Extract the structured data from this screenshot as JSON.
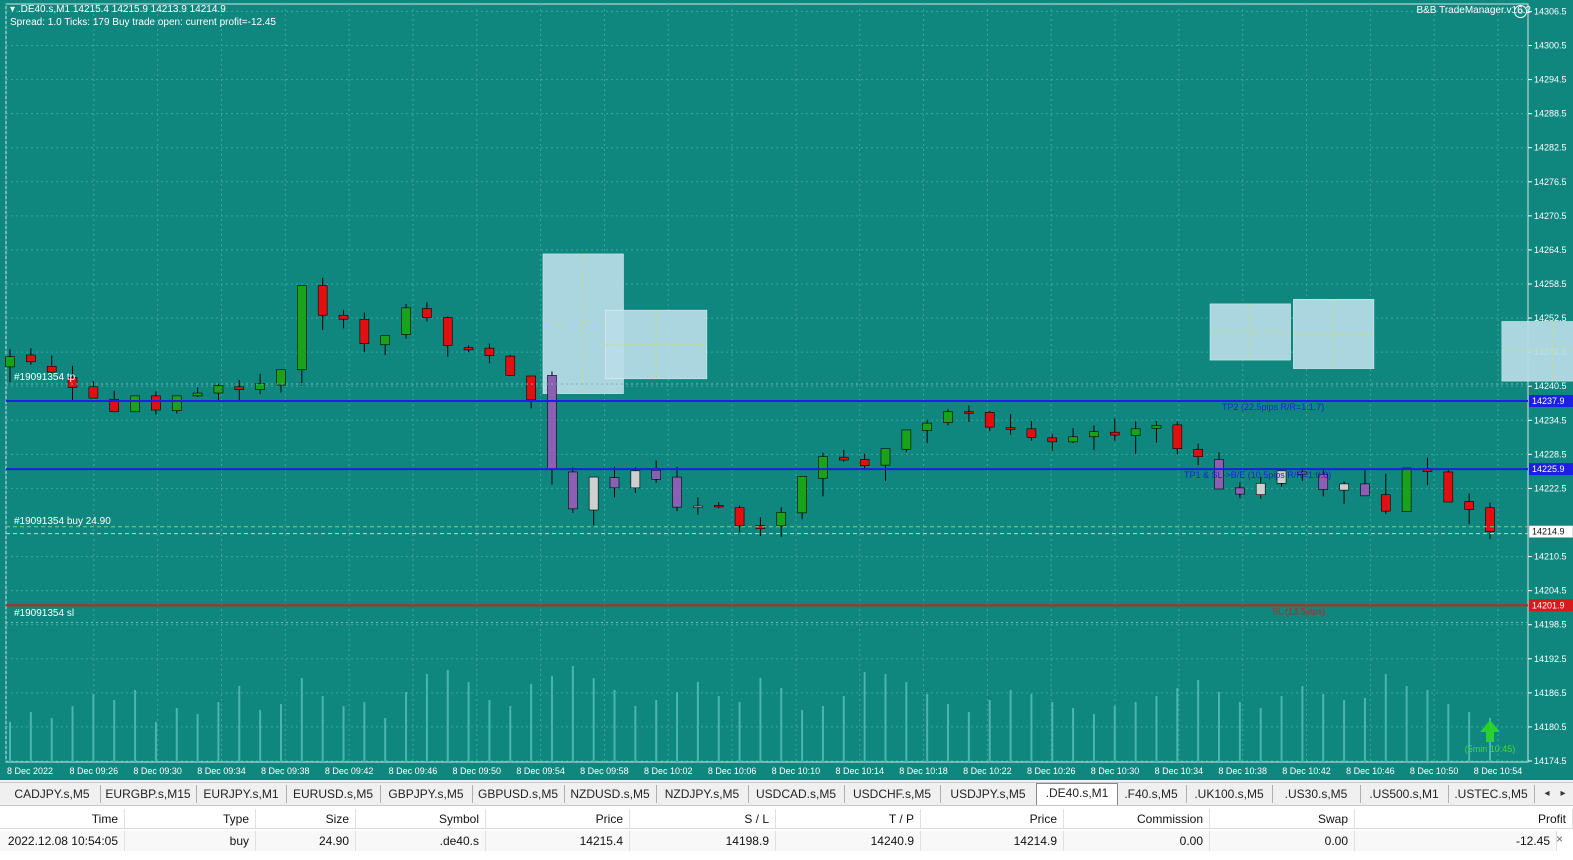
{
  "header": {
    "symbol_line": ".DE40.s,M1  14215.4 14215.9 14213.9 14214.9",
    "status_line": "Spread: 1.0   Ticks: 179   Buy trade open: current profit=-12.45",
    "brand": "B&B TradeManager.v16.2",
    "brand_icon": "smiley-icon"
  },
  "colors": {
    "background": "#0f867e",
    "bull": "#1aa31a",
    "bear": "#e01010",
    "pattern_box": "#b9dde8",
    "pattern_candle": "#8a5fb4",
    "tp_line": "#1e1ee6",
    "sl_line": "#d81a1a",
    "arrow": "#2ad12a"
  },
  "price_axis": {
    "labels": [
      "14306.5",
      "14300.5",
      "14294.5",
      "14288.5",
      "14282.5",
      "14276.5",
      "14270.5",
      "14264.5",
      "14258.5",
      "14252.5",
      "14246.5",
      "14240.5",
      "14234.5",
      "14228.5",
      "14222.5",
      "14210.5",
      "14204.5",
      "14198.5",
      "14192.5",
      "14186.5",
      "14180.5",
      "14174.5"
    ],
    "current_price": "14214.9",
    "tp2_price": "14237.9",
    "tp1_price": "14225.9",
    "sl_price": "14201.9"
  },
  "time_axis": {
    "labels": [
      "8 Dec 2022",
      "8 Dec 09:26",
      "8 Dec 09:30",
      "8 Dec 09:34",
      "8 Dec 09:38",
      "8 Dec 09:42",
      "8 Dec 09:46",
      "8 Dec 09:50",
      "8 Dec 09:54",
      "8 Dec 09:58",
      "8 Dec 10:02",
      "8 Dec 10:06",
      "8 Dec 10:10",
      "8 Dec 10:14",
      "8 Dec 10:18",
      "8 Dec 10:22",
      "8 Dec 10:26",
      "8 Dec 10:30",
      "8 Dec 10:34",
      "8 Dec 10:38",
      "8 Dec 10:42",
      "8 Dec 10:46",
      "8 Dec 10:50",
      "8 Dec 10:54"
    ]
  },
  "order_labels": {
    "tp": "#19091354 tp",
    "buy": "#19091354 buy 24.90",
    "sl": "#19091354 sl"
  },
  "line_annotations": {
    "tp2": "TP2 (22.5pips R/R=1:1.7)",
    "tp1": "TP1 & SL->B/E (10.5pips R/R=1:0.8)",
    "sl": "SL (13.5pips)"
  },
  "timer": "(5min 10:45)",
  "chart_data": {
    "type": "candlestick",
    "symbol": ".DE40.s",
    "timeframe": "M1",
    "ylim": [
      14174,
      14307
    ],
    "candles": [
      {
        "o": 14243.9,
        "h": 14247.0,
        "l": 14241.2,
        "c": 14245.7
      },
      {
        "o": 14246.0,
        "h": 14247.2,
        "l": 14244.3,
        "c": 14244.8
      },
      {
        "o": 14244.0,
        "h": 14245.9,
        "l": 14242.4,
        "c": 14243.0
      },
      {
        "o": 14242.0,
        "h": 14244.1,
        "l": 14238.0,
        "c": 14240.3
      },
      {
        "o": 14240.4,
        "h": 14241.4,
        "l": 14239.5,
        "c": 14238.4
      },
      {
        "o": 14238.2,
        "h": 14239.7,
        "l": 14237.7,
        "c": 14236.0
      },
      {
        "o": 14236.0,
        "h": 14238.7,
        "l": 14236.0,
        "c": 14238.8
      },
      {
        "o": 14238.8,
        "h": 14239.6,
        "l": 14235.5,
        "c": 14236.3
      },
      {
        "o": 14236.2,
        "h": 14238.7,
        "l": 14235.7,
        "c": 14238.8
      },
      {
        "o": 14238.8,
        "h": 14240.3,
        "l": 14238.6,
        "c": 14239.3
      },
      {
        "o": 14239.3,
        "h": 14240.9,
        "l": 14237.9,
        "c": 14240.6
      },
      {
        "o": 14240.4,
        "h": 14241.6,
        "l": 14237.8,
        "c": 14239.9
      },
      {
        "o": 14239.9,
        "h": 14242.7,
        "l": 14239.1,
        "c": 14241.0
      },
      {
        "o": 14240.7,
        "h": 14243.2,
        "l": 14239.4,
        "c": 14243.4
      },
      {
        "o": 14243.4,
        "h": 14244.3,
        "l": 14240.6,
        "c": 14258.2
      },
      {
        "o": 14258.2,
        "h": 14259.6,
        "l": 14250.4,
        "c": 14253.0
      },
      {
        "o": 14253.0,
        "h": 14253.9,
        "l": 14250.7,
        "c": 14252.3
      },
      {
        "o": 14252.3,
        "h": 14253.5,
        "l": 14246.5,
        "c": 14248.0
      },
      {
        "o": 14247.8,
        "h": 14249.1,
        "l": 14246.0,
        "c": 14249.4
      },
      {
        "o": 14249.6,
        "h": 14255.0,
        "l": 14248.9,
        "c": 14254.3
      },
      {
        "o": 14254.2,
        "h": 14255.3,
        "l": 14251.9,
        "c": 14252.6
      },
      {
        "o": 14252.6,
        "h": 14252.8,
        "l": 14245.7,
        "c": 14247.7
      },
      {
        "o": 14247.3,
        "h": 14247.7,
        "l": 14246.5,
        "c": 14246.9
      },
      {
        "o": 14247.2,
        "h": 14248.0,
        "l": 14244.6,
        "c": 14245.9
      },
      {
        "o": 14245.8,
        "h": 14246.0,
        "l": 14242.3,
        "c": 14242.4
      },
      {
        "o": 14242.3,
        "h": 14242.3,
        "l": 14236.6,
        "c": 14238.1
      },
      {
        "o": 14242.4,
        "h": 14243.1,
        "l": 14223.2,
        "c": 14225.8
      },
      {
        "o": 14225.4,
        "h": 14226.2,
        "l": 14218.2,
        "c": 14218.9
      },
      {
        "o": 14218.7,
        "h": 14223.2,
        "l": 14216.0,
        "c": 14224.5
      },
      {
        "o": 14224.4,
        "h": 14226.3,
        "l": 14220.9,
        "c": 14222.6
      },
      {
        "o": 14222.6,
        "h": 14226.2,
        "l": 14221.7,
        "c": 14225.6
      },
      {
        "o": 14225.7,
        "h": 14227.4,
        "l": 14223.5,
        "c": 14224.1
      },
      {
        "o": 14224.5,
        "h": 14226.3,
        "l": 14218.5,
        "c": 14219.2
      },
      {
        "o": 14219.3,
        "h": 14220.9,
        "l": 14217.9,
        "c": 14219.4
      },
      {
        "o": 14219.5,
        "h": 14220.1,
        "l": 14219.0,
        "c": 14219.4
      },
      {
        "o": 14219.1,
        "h": 14219.5,
        "l": 14214.8,
        "c": 14215.9
      },
      {
        "o": 14216.0,
        "h": 14217.4,
        "l": 14214.1,
        "c": 14215.4
      },
      {
        "o": 14215.9,
        "h": 14219.2,
        "l": 14214.0,
        "c": 14218.3
      },
      {
        "o": 14218.2,
        "h": 14223.7,
        "l": 14217.1,
        "c": 14224.6
      },
      {
        "o": 14224.3,
        "h": 14228.8,
        "l": 14221.1,
        "c": 14228.1
      },
      {
        "o": 14228.0,
        "h": 14229.3,
        "l": 14227.2,
        "c": 14227.5
      },
      {
        "o": 14227.6,
        "h": 14228.6,
        "l": 14225.7,
        "c": 14226.5
      },
      {
        "o": 14226.6,
        "h": 14227.5,
        "l": 14223.8,
        "c": 14229.5
      },
      {
        "o": 14229.4,
        "h": 14232.3,
        "l": 14228.9,
        "c": 14232.8
      },
      {
        "o": 14232.7,
        "h": 14234.6,
        "l": 14230.5,
        "c": 14234.0
      },
      {
        "o": 14234.1,
        "h": 14236.5,
        "l": 14233.6,
        "c": 14236.0
      },
      {
        "o": 14236.0,
        "h": 14237.1,
        "l": 14234.2,
        "c": 14235.9
      },
      {
        "o": 14235.9,
        "h": 14236.1,
        "l": 14232.6,
        "c": 14233.3
      },
      {
        "o": 14233.2,
        "h": 14235.6,
        "l": 14232.0,
        "c": 14232.9
      },
      {
        "o": 14233.0,
        "h": 14234.4,
        "l": 14230.9,
        "c": 14231.5
      },
      {
        "o": 14231.4,
        "h": 14232.1,
        "l": 14229.1,
        "c": 14230.7
      },
      {
        "o": 14230.7,
        "h": 14233.1,
        "l": 14230.5,
        "c": 14231.6
      },
      {
        "o": 14231.6,
        "h": 14233.6,
        "l": 14229.3,
        "c": 14232.5
      },
      {
        "o": 14232.4,
        "h": 14234.8,
        "l": 14230.9,
        "c": 14231.9
      },
      {
        "o": 14231.8,
        "h": 14234.3,
        "l": 14228.6,
        "c": 14233.0
      },
      {
        "o": 14233.1,
        "h": 14234.4,
        "l": 14230.6,
        "c": 14233.6
      },
      {
        "o": 14233.7,
        "h": 14234.3,
        "l": 14228.5,
        "c": 14229.5
      },
      {
        "o": 14229.4,
        "h": 14230.4,
        "l": 14226.6,
        "c": 14228.1
      },
      {
        "o": 14227.6,
        "h": 14228.9,
        "l": 14222.7,
        "c": 14222.4
      },
      {
        "o": 14222.6,
        "h": 14223.6,
        "l": 14220.8,
        "c": 14221.5
      },
      {
        "o": 14221.4,
        "h": 14224.5,
        "l": 14220.7,
        "c": 14223.4
      },
      {
        "o": 14223.4,
        "h": 14225.0,
        "l": 14222.8,
        "c": 14225.6
      },
      {
        "o": 14225.4,
        "h": 14226.1,
        "l": 14223.8,
        "c": 14225.0
      },
      {
        "o": 14225.0,
        "h": 14225.8,
        "l": 14221.1,
        "c": 14222.3
      },
      {
        "o": 14222.2,
        "h": 14223.7,
        "l": 14219.8,
        "c": 14223.3
      },
      {
        "o": 14223.3,
        "h": 14225.9,
        "l": 14221.3,
        "c": 14221.2
      },
      {
        "o": 14221.4,
        "h": 14225.1,
        "l": 14218.0,
        "c": 14218.5
      },
      {
        "o": 14218.4,
        "h": 14224.6,
        "l": 14218.6,
        "c": 14226.1
      },
      {
        "o": 14226.0,
        "h": 14227.9,
        "l": 14223.1,
        "c": 14225.5
      },
      {
        "o": 14225.4,
        "h": 14225.9,
        "l": 14220.3,
        "c": 14220.1
      },
      {
        "o": 14220.2,
        "h": 14221.6,
        "l": 14216.2,
        "c": 14218.8
      },
      {
        "o": 14219.1,
        "h": 14220.0,
        "l": 14213.6,
        "c": 14214.9
      }
    ],
    "volume": [
      20,
      25,
      22,
      28,
      34,
      31,
      36,
      20,
      27,
      24,
      30,
      38,
      26,
      29,
      42,
      33,
      28,
      30,
      22,
      35,
      44,
      46,
      40,
      31,
      28,
      39,
      43,
      48,
      42,
      36,
      28,
      31,
      35,
      40,
      33,
      30,
      42,
      37,
      26,
      28,
      33,
      45,
      44,
      40,
      34,
      29,
      25,
      31,
      36,
      34,
      30,
      27,
      24,
      28,
      30,
      33,
      37,
      41,
      35,
      30,
      27,
      33,
      38,
      34,
      31,
      32,
      44,
      38,
      36,
      29,
      25,
      22
    ],
    "pattern_boxes": [
      {
        "from": 26,
        "to": 29,
        "high": 14263.8,
        "low": 14239.2
      },
      {
        "from": 29,
        "to": 33,
        "high": 14253.9,
        "low": 14241.8
      },
      {
        "from": 58,
        "to": 61,
        "high": 14255.0,
        "low": 14245.1
      },
      {
        "from": 62,
        "to": 65,
        "high": 14255.8,
        "low": 14243.6
      },
      {
        "from": 72,
        "to": 76,
        "high": 14251.9,
        "low": 14241.4
      }
    ],
    "horizontal_lines": [
      {
        "name": "tp2",
        "price": 14237.9
      },
      {
        "name": "tp1",
        "price": 14225.9
      },
      {
        "name": "sl",
        "price": 14201.9
      }
    ]
  },
  "tabs": {
    "items": [
      "CADJPY.s,M5",
      "EURGBP.s,M15",
      "EURJPY.s,M1",
      "EURUSD.s,M5",
      "GBPJPY.s,M5",
      "GBPUSD.s,M5",
      "NZDUSD.s,M5",
      "NZDJPY.s,M5",
      "USDCAD.s,M5",
      "USDCHF.s,M5",
      "USDJPY.s,M5",
      ".DE40.s,M1",
      ".F40.s,M5",
      ".UK100.s,M5",
      ".US30.s,M5",
      ".US500.s,M1",
      ".USTEC.s,M5"
    ],
    "active_index": 11
  },
  "trade_table": {
    "columns": [
      "Time",
      "Type",
      "Size",
      "Symbol",
      "Price",
      "S / L",
      "T / P",
      "Price",
      "Commission",
      "Swap",
      "Profit"
    ],
    "row": [
      "2022.12.08 10:54:05",
      "buy",
      "24.90",
      ".de40.s",
      "14215.4",
      "14198.9",
      "14240.9",
      "14214.9",
      "0.00",
      "0.00",
      "-12.45"
    ]
  }
}
